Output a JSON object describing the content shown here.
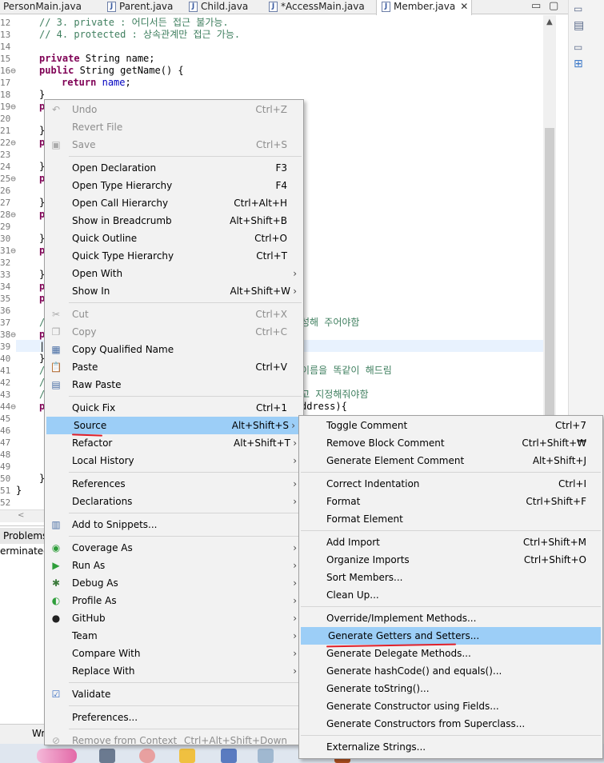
{
  "tabs": [
    {
      "label": "PersonMain.java",
      "active": false
    },
    {
      "label": "Parent.java",
      "active": false
    },
    {
      "label": "Child.java",
      "active": false
    },
    {
      "label": "*AccessMain.java",
      "active": false
    },
    {
      "label": "Member.java",
      "active": true
    }
  ],
  "window": {
    "minimize": "▭",
    "maximize": "▢",
    "tab_close": "✕"
  },
  "editor": {
    "line_numbers": [
      "12",
      "13",
      "14",
      "15",
      "16⊖",
      "17",
      "18",
      "19⊖",
      "20",
      "21",
      "22⊖",
      "23",
      "24",
      "25⊖",
      "26",
      "27",
      "28⊖",
      "29",
      "30",
      "31⊖",
      "32",
      "33",
      "34",
      "35",
      "36",
      "37",
      "38⊖",
      "39",
      "40",
      "41",
      "42",
      "43",
      "44⊖",
      "45",
      "46",
      "47",
      "48",
      "49",
      "50",
      "51",
      "52"
    ],
    "lines": {
      "l12": "// 3. private : 어디서든 접근 불가능.",
      "l13": "// 4. protected : 상속관계만 접근 가능.",
      "l15_kw": "private",
      "l15_rest": " String name;",
      "l16_kw": "public",
      "l16_rest": " String getName() {",
      "l17_kw": "return",
      "l17_fld": "name",
      "l17_end": ";",
      "l18": "}",
      "l19": "p",
      "l21": "}",
      "l22": "p",
      "l24": "}",
      "l25": "p",
      "l27": "}",
      "l28": "p",
      "l30": "}",
      "l31": "p",
      "l33": "}",
      "l34": "p",
      "l35": "p",
      "l37": "/",
      "l37_tail": "성해 주어야함",
      "l38": "p",
      "l39": "|",
      "l40": "}",
      "l41": "/",
      "l41_tail": "이름을 똑같이 해드림",
      "l42": "/",
      "l43": "/",
      "l43_tail": "고 지정해줘야함",
      "l44": "p",
      "l44_tail": "ddress){",
      "l50": "}",
      "l51": "}"
    }
  },
  "bottom": {
    "problems_tab": "Problems",
    "terminated": "erminated>",
    "bottom_tab": "Wr",
    "hscroll_left": "<"
  },
  "context_menu": {
    "items": [
      {
        "label": "Undo",
        "shortcut": "Ctrl+Z",
        "icon": "undo-icon",
        "disabled": true
      },
      {
        "label": "Revert File",
        "shortcut": "",
        "icon": "",
        "disabled": true
      },
      {
        "label": "Save",
        "shortcut": "Ctrl+S",
        "icon": "save-icon",
        "disabled": true
      },
      {
        "label": "Open Declaration",
        "shortcut": "F3"
      },
      {
        "label": "Open Type Hierarchy",
        "shortcut": "F4"
      },
      {
        "label": "Open Call Hierarchy",
        "shortcut": "Ctrl+Alt+H"
      },
      {
        "label": "Show in Breadcrumb",
        "shortcut": "Alt+Shift+B"
      },
      {
        "label": "Quick Outline",
        "shortcut": "Ctrl+O"
      },
      {
        "label": "Quick Type Hierarchy",
        "shortcut": "Ctrl+T"
      },
      {
        "label": "Open With",
        "shortcut": "",
        "submenu": true
      },
      {
        "label": "Show In",
        "shortcut": "Alt+Shift+W",
        "submenu": true
      },
      {
        "label": "Cut",
        "shortcut": "Ctrl+X",
        "icon": "cut-icon",
        "disabled": true
      },
      {
        "label": "Copy",
        "shortcut": "Ctrl+C",
        "icon": "copy-icon",
        "disabled": true
      },
      {
        "label": "Copy Qualified Name",
        "shortcut": "",
        "icon": "copy-qualified-icon"
      },
      {
        "label": "Paste",
        "shortcut": "Ctrl+V",
        "icon": "paste-icon"
      },
      {
        "label": "Raw Paste",
        "shortcut": "",
        "icon": "raw-paste-icon"
      },
      {
        "label": "Quick Fix",
        "shortcut": "Ctrl+1"
      },
      {
        "label": "Source",
        "shortcut": "Alt+Shift+S",
        "submenu": true,
        "highlighted": true
      },
      {
        "label": "Refactor",
        "shortcut": "Alt+Shift+T",
        "submenu": true
      },
      {
        "label": "Local History",
        "shortcut": "",
        "submenu": true
      },
      {
        "label": "References",
        "shortcut": "",
        "submenu": true
      },
      {
        "label": "Declarations",
        "shortcut": "",
        "submenu": true
      },
      {
        "label": "Add to Snippets...",
        "shortcut": "",
        "icon": "snippets-icon"
      },
      {
        "label": "Coverage As",
        "shortcut": "",
        "icon": "coverage-icon",
        "submenu": true
      },
      {
        "label": "Run As",
        "shortcut": "",
        "icon": "run-icon",
        "submenu": true
      },
      {
        "label": "Debug As",
        "shortcut": "",
        "icon": "debug-icon",
        "submenu": true
      },
      {
        "label": "Profile As",
        "shortcut": "",
        "icon": "profile-icon",
        "submenu": true
      },
      {
        "label": "GitHub",
        "shortcut": "",
        "icon": "github-icon",
        "submenu": true
      },
      {
        "label": "Team",
        "shortcut": "",
        "submenu": true
      },
      {
        "label": "Compare With",
        "shortcut": "",
        "submenu": true
      },
      {
        "label": "Replace With",
        "shortcut": "",
        "submenu": true
      },
      {
        "label": "Validate",
        "shortcut": "",
        "icon": "checkmark-icon"
      },
      {
        "label": "Preferences...",
        "shortcut": ""
      },
      {
        "label": "Remove from Context",
        "shortcut": "Ctrl+Alt+Shift+Down",
        "icon": "context-icon",
        "disabled": true
      }
    ]
  },
  "source_submenu": {
    "items": [
      {
        "label": "Toggle Comment",
        "shortcut": "Ctrl+7"
      },
      {
        "label": "Remove Block Comment",
        "shortcut": "Ctrl+Shift+₩"
      },
      {
        "label": "Generate Element Comment",
        "shortcut": "Alt+Shift+J"
      },
      {
        "label": "Correct Indentation",
        "shortcut": "Ctrl+I"
      },
      {
        "label": "Format",
        "shortcut": "Ctrl+Shift+F"
      },
      {
        "label": "Format Element",
        "shortcut": ""
      },
      {
        "label": "Add Import",
        "shortcut": "Ctrl+Shift+M"
      },
      {
        "label": "Organize Imports",
        "shortcut": "Ctrl+Shift+O"
      },
      {
        "label": "Sort Members...",
        "shortcut": ""
      },
      {
        "label": "Clean Up...",
        "shortcut": ""
      },
      {
        "label": "Override/Implement Methods...",
        "shortcut": ""
      },
      {
        "label": "Generate Getters and Setters...",
        "shortcut": "",
        "highlighted": true
      },
      {
        "label": "Generate Delegate Methods...",
        "shortcut": ""
      },
      {
        "label": "Generate hashCode() and equals()...",
        "shortcut": ""
      },
      {
        "label": "Generate toString()...",
        "shortcut": ""
      },
      {
        "label": "Generate Constructor using Fields...",
        "shortcut": ""
      },
      {
        "label": "Generate Constructors from Superclass...",
        "shortcut": ""
      },
      {
        "label": "Externalize Strings...",
        "shortcut": ""
      }
    ]
  },
  "colors": {
    "highlight": "#9ccef7",
    "annotation_underline": "#e0202a",
    "comment": "#3f7f5f",
    "keyword": "#7f0055",
    "field": "#0000c0"
  }
}
